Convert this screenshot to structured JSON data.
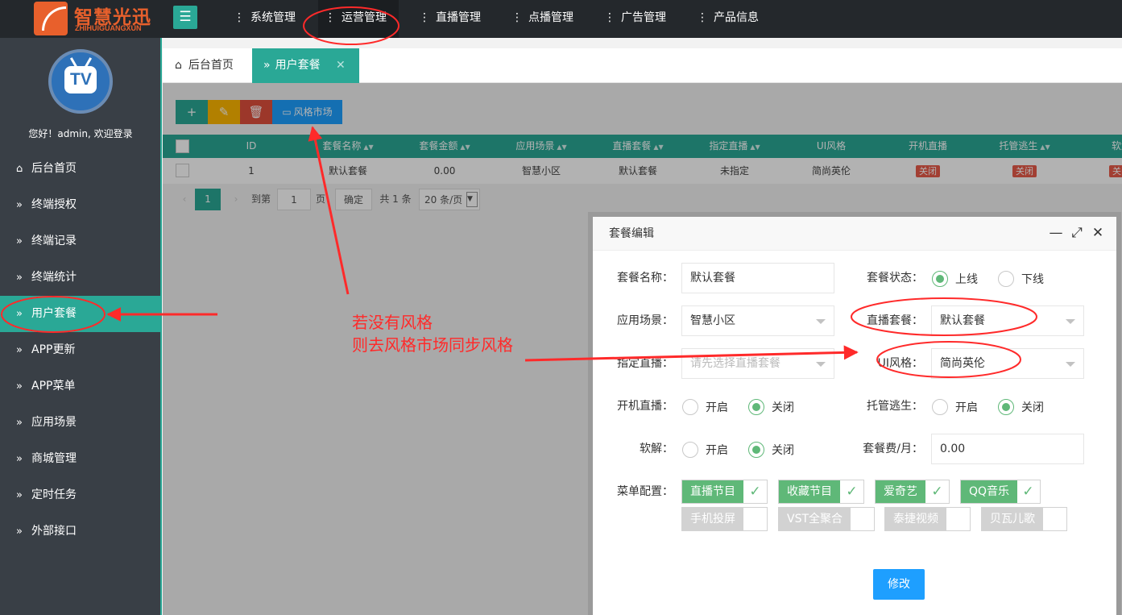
{
  "brand": {
    "name": "智慧光迅",
    "subtitle": "ZHIHUIGUANGXUN"
  },
  "topnav": {
    "toggle_icon": "☰",
    "dots": "⋮",
    "items": [
      {
        "label": "系统管理"
      },
      {
        "label": "运营管理",
        "active": true
      },
      {
        "label": "直播管理"
      },
      {
        "label": "点播管理"
      },
      {
        "label": "广告管理"
      },
      {
        "label": "产品信息"
      }
    ]
  },
  "sidebar": {
    "avatar_text": "TV",
    "welcome": "您好！admin, 欢迎登录",
    "items": [
      {
        "label": "后台首页",
        "icon": "home-icon"
      },
      {
        "label": "终端授权",
        "icon": "double-chevron-icon"
      },
      {
        "label": "终端记录",
        "icon": "double-chevron-icon"
      },
      {
        "label": "终端统计",
        "icon": "double-chevron-icon"
      },
      {
        "label": "用户套餐",
        "icon": "double-chevron-icon",
        "active": true
      },
      {
        "label": "APP更新",
        "icon": "double-chevron-icon"
      },
      {
        "label": "APP菜单",
        "icon": "double-chevron-icon"
      },
      {
        "label": "应用场景",
        "icon": "double-chevron-icon"
      },
      {
        "label": "商城管理",
        "icon": "double-chevron-icon"
      },
      {
        "label": "定时任务",
        "icon": "double-chevron-icon"
      },
      {
        "label": "外部接口",
        "icon": "double-chevron-icon"
      }
    ]
  },
  "tabs": {
    "home": "后台首页",
    "current": "用户套餐",
    "close": "✕"
  },
  "toolbar": {
    "add": "+",
    "style_market": "风格市场",
    "colors": {
      "add": "#2aa896",
      "edit": "#ffb800",
      "delete": "#e04f3d",
      "market": "#1e9fff"
    }
  },
  "table": {
    "headers": [
      "ID",
      "套餐名称",
      "套餐金额",
      "应用场景",
      "直播套餐",
      "指定直播",
      "UI风格",
      "开机直播",
      "托管逃生",
      "软解"
    ],
    "sortable": [
      false,
      true,
      true,
      true,
      true,
      true,
      false,
      false,
      true,
      false
    ],
    "rows": [
      [
        "1",
        "默认套餐",
        "0.00",
        "智慧小区",
        "默认套餐",
        "未指定",
        "简尚英伦",
        "关闭",
        "关闭",
        "关闭"
      ]
    ]
  },
  "pager": {
    "current": "1",
    "goto_label": "到第",
    "goto_value": "1",
    "page_unit": "页",
    "confirm": "确定",
    "total": "共 1 条",
    "per_page": "20 条/页"
  },
  "modal": {
    "title": "套餐编辑",
    "name_label": "套餐名称：",
    "name_value": "默认套餐",
    "status_label": "套餐状态：",
    "status_online": "上线",
    "status_offline": "下线",
    "scene_label": "应用场景：",
    "scene_value": "智慧小区",
    "live_pkg_label": "直播套餐：",
    "live_pkg_value": "默认套餐",
    "assign_label": "指定直播：",
    "assign_placeholder": "请先选择直播套餐",
    "ui_label": "UI风格：",
    "ui_value": "简尚英伦",
    "boot_label": "开机直播：",
    "escape_label": "托管逃生：",
    "soft_label": "软解：",
    "fee_label": "套餐费/月：",
    "fee_value": "0.00",
    "on_text": "开启",
    "off_text": "关闭",
    "menu_label": "菜单配置：",
    "menu_items": [
      {
        "label": "直播节目",
        "checked": true
      },
      {
        "label": "收藏节目",
        "checked": true
      },
      {
        "label": "爱奇艺",
        "checked": true
      },
      {
        "label": "QQ音乐",
        "checked": true
      },
      {
        "label": "手机投屏",
        "checked": false
      },
      {
        "label": "VST全聚合",
        "checked": false
      },
      {
        "label": "泰捷视频",
        "checked": false
      },
      {
        "label": "贝瓦儿歌",
        "checked": false
      }
    ],
    "submit": "修改"
  },
  "annotation": {
    "line1": "若没有风格",
    "line2": "则去风格市场同步风格",
    "color": "#ff2a2a"
  }
}
